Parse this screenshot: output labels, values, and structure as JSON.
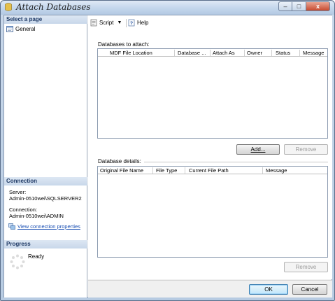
{
  "window": {
    "title": "Attach Databases",
    "caption_min": "–",
    "caption_max": "□",
    "caption_close": "x"
  },
  "left": {
    "select_page_head": "Select a page",
    "pages": [
      {
        "label": "General"
      }
    ],
    "connection_head": "Connection",
    "server_label": "Server:",
    "server_value": "Admin-0510wei\\SQLSERVER2",
    "connection_label": "Connection:",
    "connection_value": "Admin-0510wei\\ADMIN",
    "view_connection_link": "View connection properties",
    "progress_head": "Progress",
    "progress_status": "Ready"
  },
  "toolbar": {
    "script_label": "Script",
    "help_label": "Help"
  },
  "databases_to_attach": {
    "label": "Databases to attach:",
    "columns": [
      "MDF File Location",
      "Database ...",
      "Attach As",
      "Owner",
      "Status",
      "Message"
    ],
    "rows": [],
    "add_button": "Add...",
    "remove_button": "Remove"
  },
  "database_details": {
    "label": "Database details:",
    "columns": [
      "Original File Name",
      "File Type",
      "Current File Path",
      "Message"
    ],
    "rows": [],
    "remove_button": "Remove"
  },
  "footer": {
    "ok_button": "OK",
    "cancel_button": "Cancel"
  },
  "colors": {
    "header_text": "#1f3a66",
    "link": "#1a4fb3",
    "frame": "#b7cbe2"
  }
}
